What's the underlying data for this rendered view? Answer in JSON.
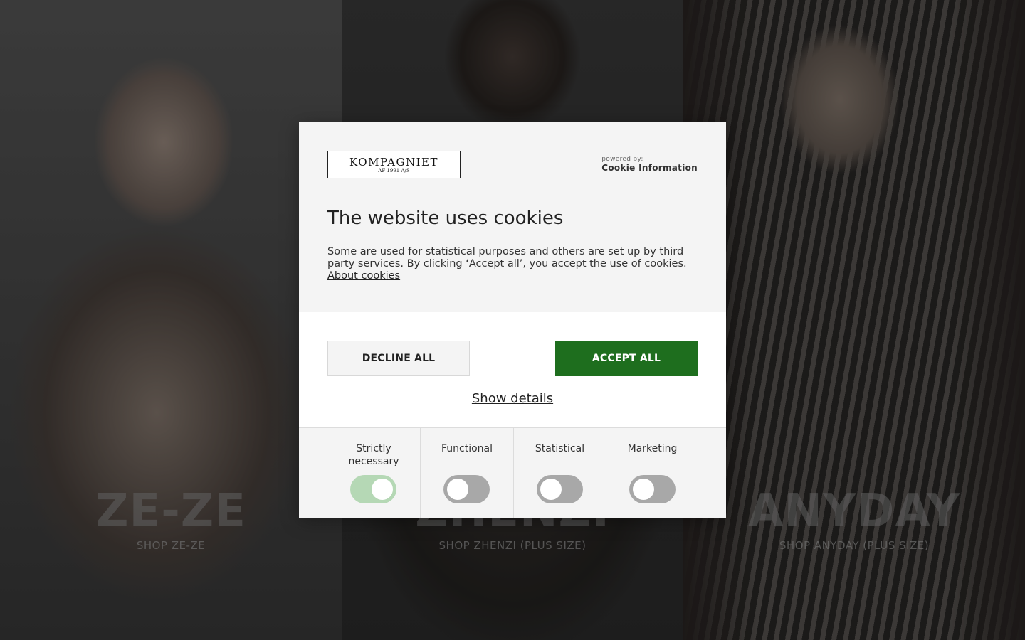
{
  "background": {
    "panels": [
      {
        "brand": "ZE-ZE",
        "link": "SHOP ZE-ZE"
      },
      {
        "brand": "ZHENZI",
        "link": "SHOP ZHENZI (PLUS SIZE)"
      },
      {
        "brand": "ANYDAY",
        "link": "SHOP ANYDAY (PLUS SIZE)"
      }
    ]
  },
  "dialog": {
    "logo": {
      "main": "KOMPAGNIET",
      "sub": "AF 1991 A/S"
    },
    "powered_by": {
      "label": "powered by:",
      "name": "Cookie Information"
    },
    "title": "The website uses cookies",
    "description": "Some are used for statistical purposes and others are set up by third party services. By clicking ‘Accept all’, you accept the use of cookies.",
    "about_link": "About cookies",
    "buttons": {
      "decline": "DECLINE ALL",
      "accept": "ACCEPT ALL"
    },
    "show_details": "Show details",
    "categories": [
      {
        "label": "Strictly necessary",
        "enabled": true
      },
      {
        "label": "Functional",
        "enabled": false
      },
      {
        "label": "Statistical",
        "enabled": false
      },
      {
        "label": "Marketing",
        "enabled": false
      }
    ],
    "colors": {
      "accept": "#1e6e1e",
      "toggle_on": "#b5d8b5",
      "toggle_off": "#a8a8a8"
    }
  }
}
